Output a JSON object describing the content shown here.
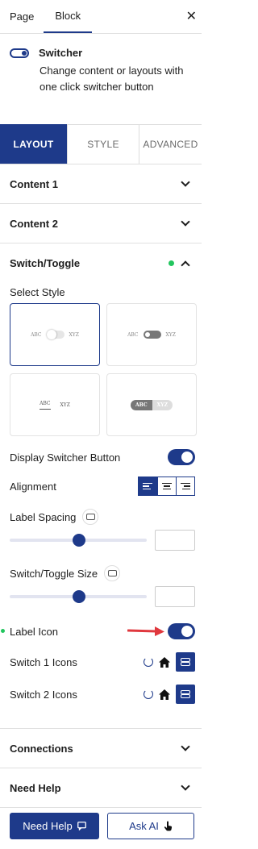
{
  "topbar": {
    "tabs": [
      "Page",
      "Block"
    ],
    "active_tab": "Block",
    "close_glyph": "✕"
  },
  "block": {
    "title": "Switcher",
    "description": "Change content or layouts with one click switcher button"
  },
  "settings_tabs": [
    "LAYOUT",
    "STYLE",
    "ADVANCED"
  ],
  "panels": {
    "content1": "Content 1",
    "content2": "Content 2",
    "switch_toggle": "Switch/Toggle",
    "connections": "Connections",
    "need_help": "Need Help"
  },
  "switch": {
    "select_style_label": "Select Style",
    "styles": [
      {
        "left": "ABC",
        "right": "XYZ"
      },
      {
        "left": "ABC",
        "right": "XYZ"
      },
      {
        "left": "ABC",
        "right": "XYZ"
      },
      {
        "left": "ABC",
        "right": "XYZ"
      }
    ],
    "display_switcher_label": "Display Switcher Button",
    "alignment_label": "Alignment",
    "label_spacing_label": "Label Spacing",
    "label_spacing_value": "",
    "size_label": "Switch/Toggle Size",
    "size_value": "",
    "label_icon_label": "Label Icon",
    "switch1_icons_label": "Switch 1 Icons",
    "switch2_icons_label": "Switch 2 Icons"
  },
  "footer": {
    "need_help": "Need Help",
    "ask_ai": "Ask AI"
  },
  "colors": {
    "accent": "#1e3a8a",
    "green_dot": "#22c55e",
    "arrow": "#e0383e"
  }
}
